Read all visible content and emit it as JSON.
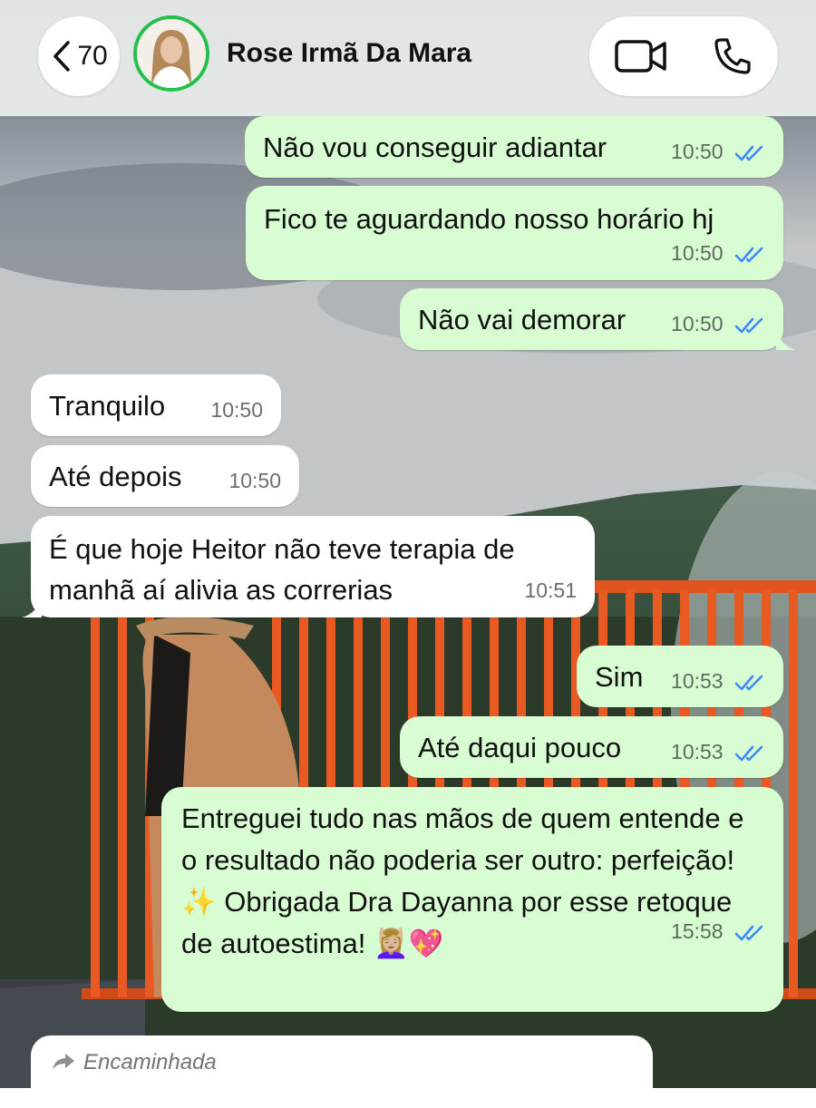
{
  "header": {
    "back_count": "70",
    "contact_name": "Rose Irmã Da Mara",
    "icons": [
      "chevron-left-icon",
      "video-call-icon",
      "phone-icon"
    ]
  },
  "messages": [
    {
      "dir": "out",
      "text": "Não vou conseguir adiantar",
      "time": "10:50",
      "status": "read"
    },
    {
      "dir": "out",
      "text": "Fico te aguardando nosso horário hj",
      "time": "10:50",
      "status": "read"
    },
    {
      "dir": "out",
      "text": "Não vai demorar",
      "time": "10:50",
      "status": "read"
    },
    {
      "dir": "in",
      "text": "Tranquilo",
      "time": "10:50"
    },
    {
      "dir": "in",
      "text": "Até depois",
      "time": "10:50"
    },
    {
      "dir": "in",
      "text": "É que hoje Heitor não teve terapia de manhã aí alivia as correrias",
      "time": "10:51"
    },
    {
      "dir": "out",
      "text": "Sim",
      "time": "10:53",
      "status": "read"
    },
    {
      "dir": "out",
      "text": "Até daqui pouco",
      "time": "10:53",
      "status": "read"
    },
    {
      "dir": "out",
      "text": "Entreguei tudo nas mãos de quem entende e o resultado não poderia ser outro: perfeição! ✨ Obrigada Dra Dayanna por esse retoque de autoestima! 💆🏼‍♀️💖",
      "time": "15:58",
      "status": "read"
    }
  ],
  "forwarded": {
    "label": "Encaminhada",
    "icon": "forward-arrow-icon"
  },
  "colors": {
    "outgoing_bubble": "#d9fdd3",
    "incoming_bubble": "#ffffff",
    "read_ticks": "#3d8af7",
    "avatar_ring": "#25c04a"
  }
}
